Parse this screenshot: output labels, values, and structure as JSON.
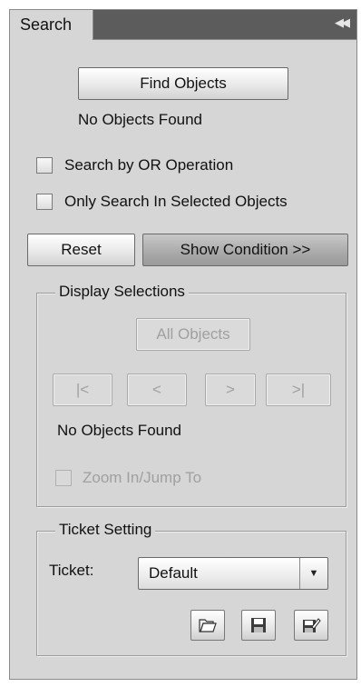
{
  "tab": {
    "label": "Search",
    "collapse_glyph": "◀◀"
  },
  "search": {
    "find_label": "Find Objects",
    "status": "No Objects Found",
    "or_operation_label": "Search by OR Operation",
    "selected_only_label": "Only Search In Selected Objects",
    "reset_label": "Reset",
    "show_condition_label": "Show Condition >>"
  },
  "display": {
    "legend": "Display Selections",
    "all_objects_label": "All Objects",
    "first_label": "|<",
    "prev_label": "<",
    "next_label": ">",
    "last_label": ">|",
    "status": "No Objects Found",
    "zoom_label": "Zoom In/Jump To"
  },
  "ticket": {
    "legend": "Ticket Setting",
    "label": "Ticket:",
    "selected": "Default",
    "arrow_glyph": "▼"
  },
  "icons": {
    "open": "folder-open-icon",
    "save": "save-icon",
    "save_as": "save-as-icon"
  }
}
